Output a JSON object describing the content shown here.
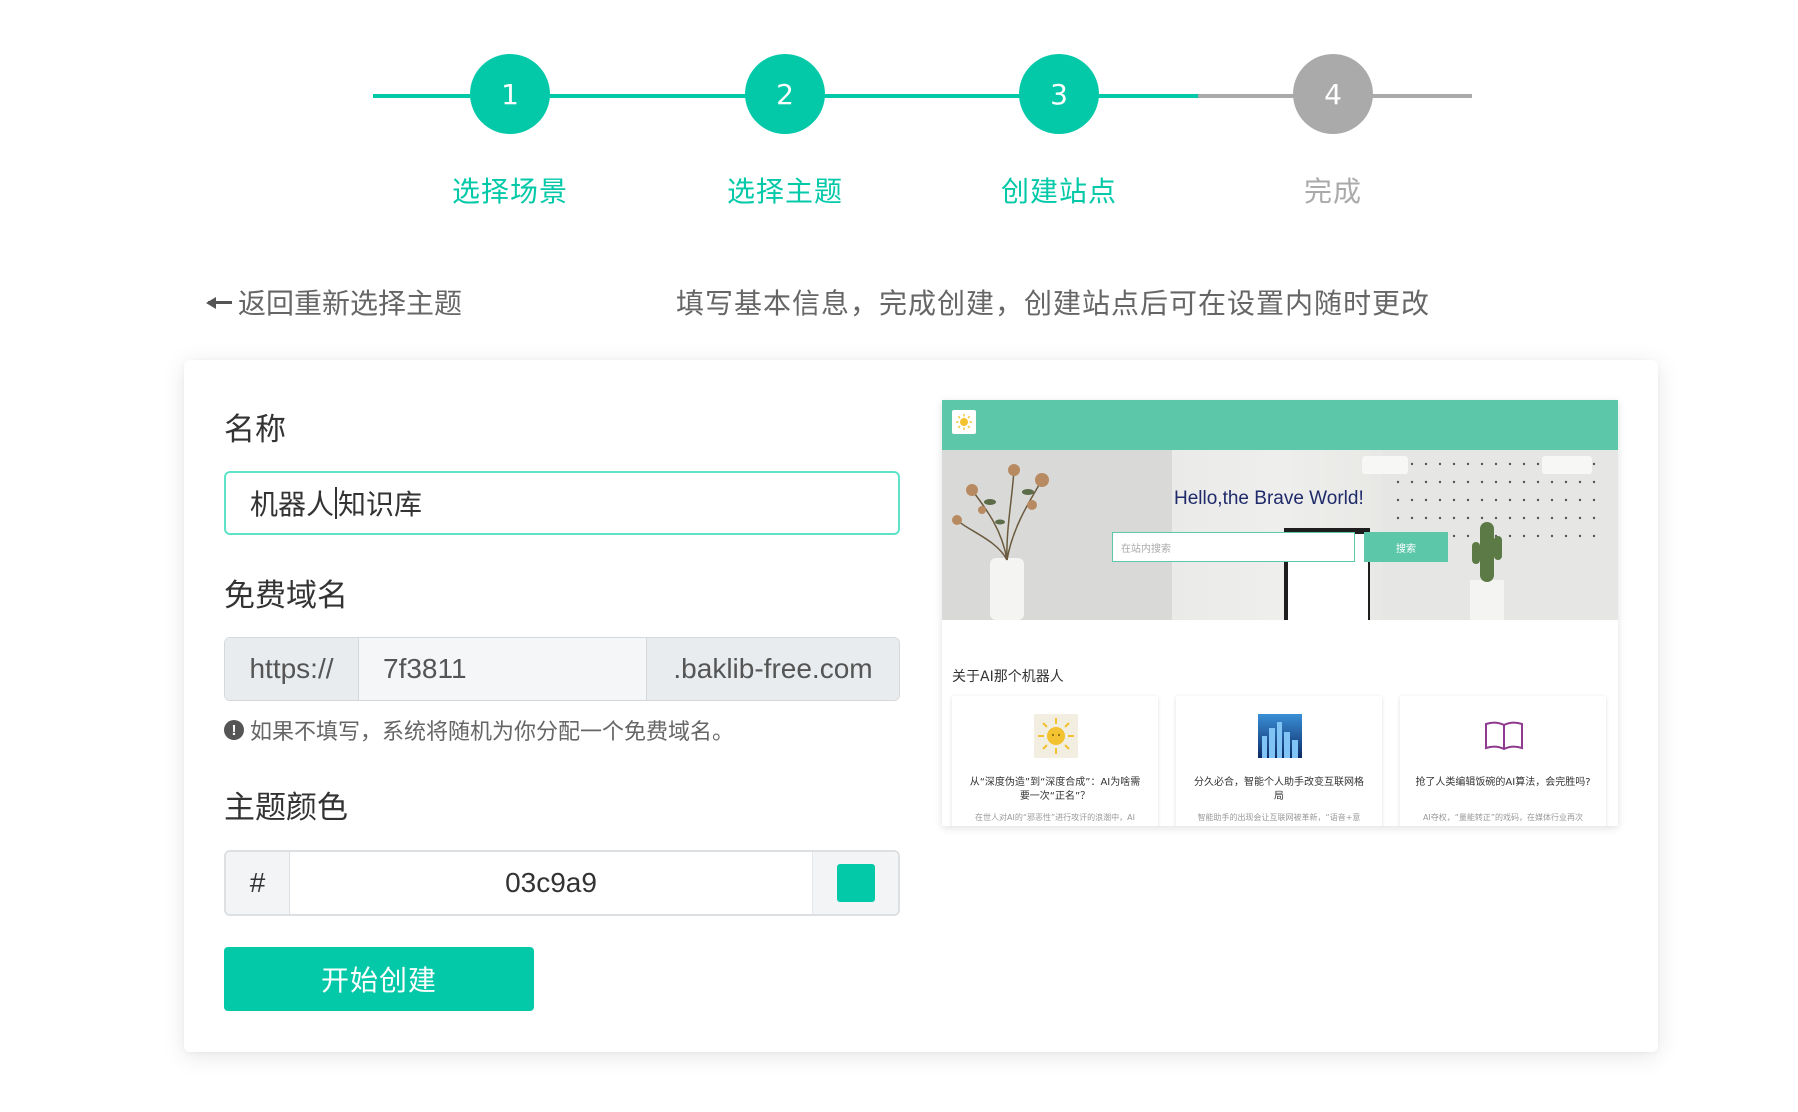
{
  "theme": {
    "accent": "#03c9a9",
    "inactive": "#aaaaaa"
  },
  "steps": [
    {
      "number": "1",
      "label": "选择场景",
      "state": "done"
    },
    {
      "number": "2",
      "label": "选择主题",
      "state": "done"
    },
    {
      "number": "3",
      "label": "创建站点",
      "state": "active"
    },
    {
      "number": "4",
      "label": "完成",
      "state": "pending"
    }
  ],
  "subheader": {
    "back_label": "返回重新选择主题",
    "hint": "填写基本信息，完成创建，创建站点后可在设置内随时更改"
  },
  "form": {
    "name_label": "名称",
    "name_value_before_caret": "机器人",
    "name_value_after_caret": "知识库",
    "domain_label": "免费域名",
    "domain_prefix": "https://",
    "domain_value": "7f3811",
    "domain_suffix": ".baklib-free.com",
    "domain_note": "如果不填写，系统将随机为你分配一个免费域名。",
    "color_label": "主题颜色",
    "color_hash": "#",
    "color_value": "03c9a9",
    "color_swatch": "#03c9a9",
    "submit_label": "开始创建"
  },
  "preview": {
    "hero_title": "Hello,the Brave World!",
    "search_placeholder": "在站内搜索",
    "search_button": "搜索",
    "section_title": "关于AI那个机器人",
    "cards": [
      {
        "icon": "sun-icon",
        "title": "从“深度伪造”到“深度合成”：AI为啥需要一次“正名”？",
        "desc": "在世人对AI的“邪恶性”进行攻讦的浪潮中，AI"
      },
      {
        "icon": "city-image",
        "title": "分久必合，智能个人助手改变互联网格局",
        "desc": "智能助手的出现会让互联网被革新，“语音+意"
      },
      {
        "icon": "book-icon",
        "title": "抢了人类编辑饭碗的AI算法，会完胜吗?",
        "desc": "AI夺权，“量能转正”的戏码，在媒体行业再次"
      }
    ]
  }
}
